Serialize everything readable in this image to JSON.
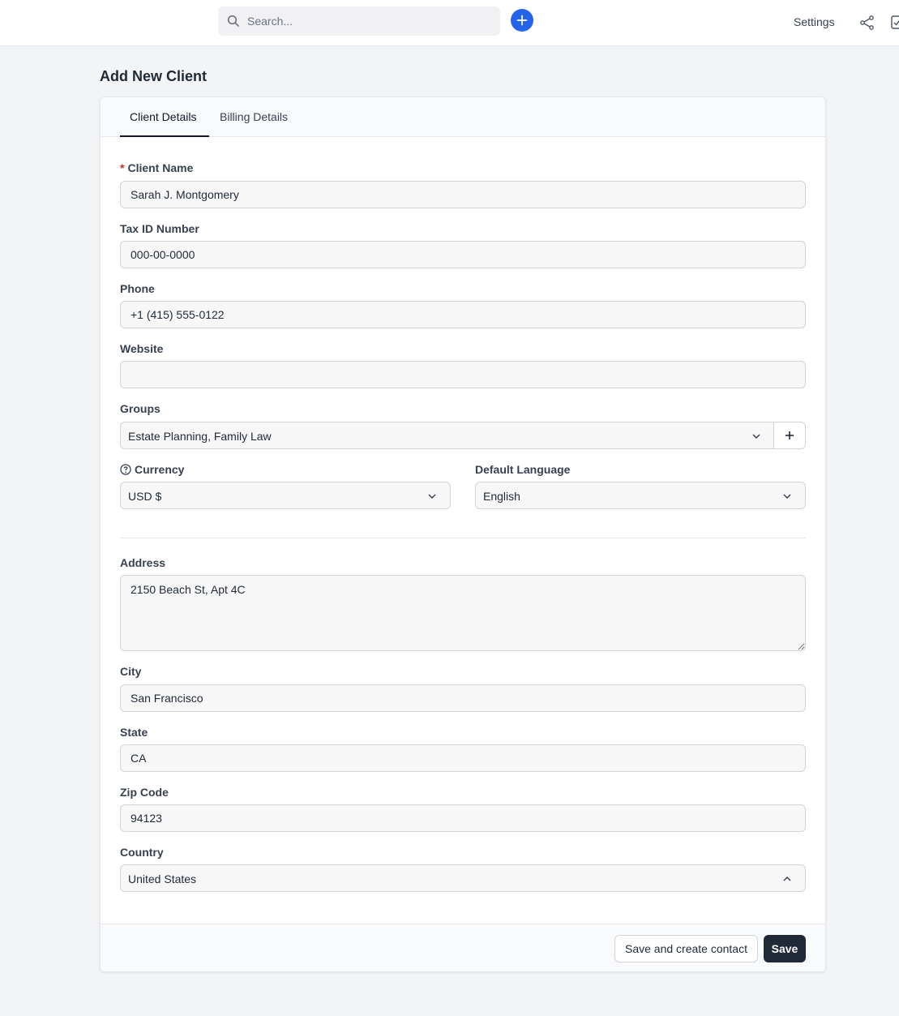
{
  "topbar": {
    "search_placeholder": "Search...",
    "settings_label": "Settings",
    "accent_color": "#2563eb"
  },
  "page": {
    "title": "Add New Client"
  },
  "tabs": [
    {
      "label": "Client Details",
      "active": true
    },
    {
      "label": "Billing Details",
      "active": false
    }
  ],
  "form": {
    "client_name": {
      "label": "Client Name",
      "required_mark": "*",
      "value": "Sarah J. Montgomery"
    },
    "tax_id": {
      "label": "Tax ID Number",
      "value": "000-00-0000"
    },
    "phone": {
      "label": "Phone",
      "value": "+1 (415) 555-0122"
    },
    "website": {
      "label": "Website",
      "value": ""
    },
    "groups": {
      "label": "Groups",
      "value": "Estate Planning, Family Law"
    },
    "currency": {
      "label": "Currency",
      "value": "USD $"
    },
    "default_language": {
      "label": "Default Language",
      "value": "English"
    },
    "address": {
      "label": "Address",
      "value": "2150 Beach St, Apt 4C"
    },
    "city": {
      "label": "City",
      "value": "San Francisco"
    },
    "state": {
      "label": "State",
      "value": "CA"
    },
    "zip": {
      "label": "Zip Code",
      "value": "94123"
    },
    "country": {
      "label": "Country",
      "value": "United States"
    }
  },
  "footer": {
    "save_and_create_label": "Save and create contact",
    "save_label": "Save"
  },
  "icons": [
    "search-icon",
    "plus-icon",
    "share-icon",
    "checkbox-icon",
    "help-circle-icon",
    "chevron-down-icon",
    "chevron-up-icon"
  ]
}
